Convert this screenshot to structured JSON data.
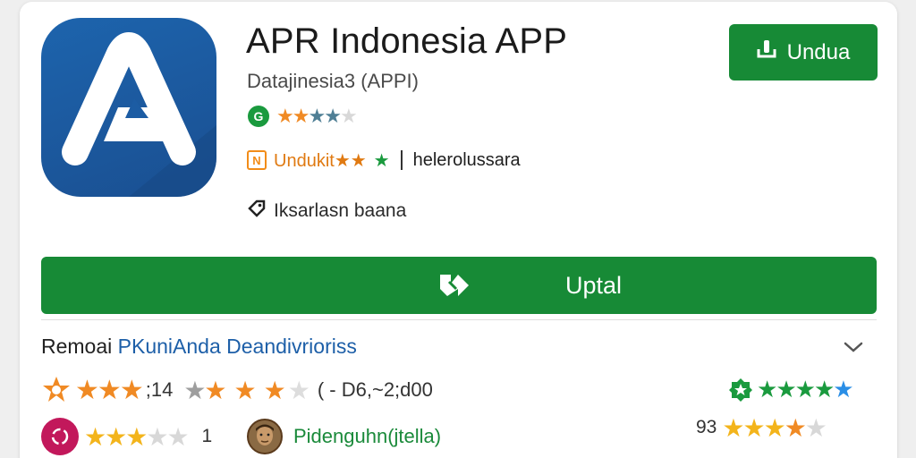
{
  "app": {
    "title": "APR Indonesia APP",
    "publisher": "Dataji­nesia3 (APPI)",
    "icon": "app-logo-icon"
  },
  "rating_row": {
    "badge": "G",
    "stars": "★★★★★"
  },
  "tag_row": {
    "tag_icon": "N",
    "tag_label": "Undukit★★",
    "tag_star": "★",
    "category": "helerolussara"
  },
  "developer_row": {
    "icon": "tag-icon",
    "text": "Iksarlasn baana"
  },
  "buttons": {
    "install_small": "Undua",
    "update_wide": "Uptal"
  },
  "reviews": {
    "section_title_prefix": "Remoai ",
    "section_title_accent": "PKuniAnda Deandivrioriss",
    "row_a": {
      "count": ";14",
      "range": "( - D6,~2;d00"
    },
    "row_b": {
      "value": "1",
      "reviewer_name": "Pidenguhn(jtella)",
      "right_count": "93"
    }
  },
  "colors": {
    "brand_green": "#178a36",
    "accent_blue": "#1d5fa8",
    "star_orange": "#f08a24",
    "star_gold": "#f3b41b",
    "star_green": "#1a9a3e",
    "star_blue": "#2a8ee6"
  }
}
